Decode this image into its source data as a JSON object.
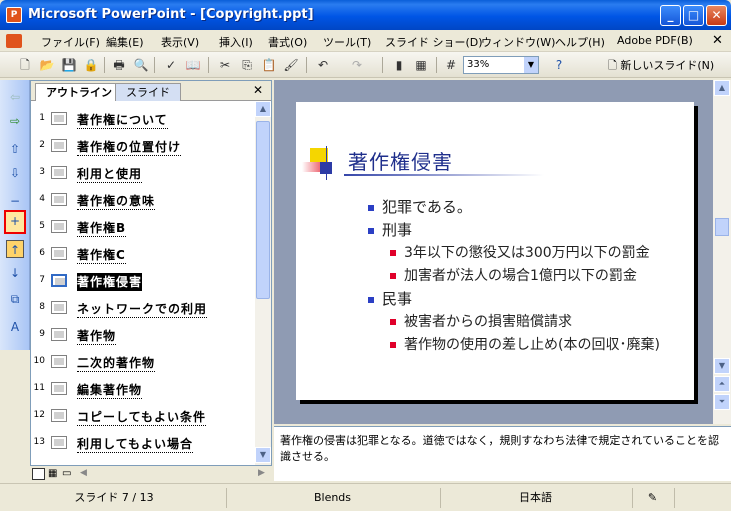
{
  "window": {
    "title": "Microsoft PowerPoint - [Copyright.ppt]"
  },
  "menu": {
    "items": [
      "ファイル(F)",
      "編集(E)",
      "表示(V)",
      "挿入(I)",
      "書式(O)",
      "ツール(T)",
      "スライド ショー(D)",
      "ウィンドウ(W)",
      "ヘルプ(H)",
      "Adobe PDF(B)"
    ]
  },
  "toolbar": {
    "zoom": "33%",
    "new_slide_label": "新しいスライド(N)"
  },
  "outline": {
    "tabs": [
      "アウトライン",
      "スライド"
    ],
    "rows": [
      {
        "num": "1",
        "text": "著作権について"
      },
      {
        "num": "2",
        "text": "著作権の位置付け"
      },
      {
        "num": "3",
        "text": "利用と使用"
      },
      {
        "num": "4",
        "text": "著作権の意味"
      },
      {
        "num": "5",
        "text": "著作権B"
      },
      {
        "num": "6",
        "text": "著作権C"
      },
      {
        "num": "7",
        "text": "著作権侵害"
      },
      {
        "num": "8",
        "text": "ネットワークでの利用"
      },
      {
        "num": "9",
        "text": "著作物"
      },
      {
        "num": "10",
        "text": "二次的著作物"
      },
      {
        "num": "11",
        "text": "編集著作物"
      },
      {
        "num": "12",
        "text": "コピーしてもよい条件"
      },
      {
        "num": "13",
        "text": "利用してもよい場合"
      }
    ],
    "selected_index": 6
  },
  "slide": {
    "title": "著作権侵害",
    "bullets": [
      {
        "level": 1,
        "text": "犯罪である。"
      },
      {
        "level": 1,
        "text": "刑事"
      },
      {
        "level": 2,
        "text": "3年以下の懲役又は300万円以下の罰金"
      },
      {
        "level": 2,
        "text": "加害者が法人の場合1億円以下の罰金"
      },
      {
        "level": 1,
        "text": "民事"
      },
      {
        "level": 2,
        "text": "被害者からの損害賠償請求"
      },
      {
        "level": 2,
        "text": "著作物の使用の差し止め(本の回収･廃棄)"
      }
    ]
  },
  "notes": {
    "text": "著作権の侵害は犯罪となる。道徳ではなく，規則すなわち法律で規定されていることを認識させる。"
  },
  "status": {
    "slide": "スライド 7 / 13",
    "design": "Blends",
    "language": "日本語"
  },
  "colors": {
    "title_blue": "#1f2f8c",
    "bullet1": "#2b3fc4",
    "bullet2": "#e0002a"
  }
}
